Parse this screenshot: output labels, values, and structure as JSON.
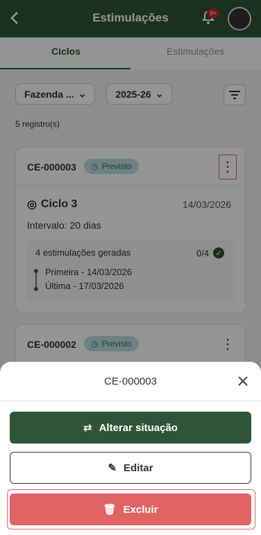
{
  "header": {
    "title": "Estimulações",
    "badge": "9+"
  },
  "tabs": [
    {
      "label": "Ciclos",
      "active": true
    },
    {
      "label": "Estimulações",
      "active": false
    }
  ],
  "filters": {
    "farm": "Fazenda ...",
    "season": "2025-26"
  },
  "results_count": "5 registro(s)",
  "cards": [
    {
      "code": "CE-000003",
      "status": "Previsto",
      "cycle_title": "Ciclo 3",
      "date": "14/03/2026",
      "interval": "Intervalo: 20 dias",
      "generated": "4 estimulações geradas",
      "progress": "0/4",
      "first": "Primeira - 14/03/2026",
      "last": "Última - 17/03/2026"
    },
    {
      "code": "CE-000002",
      "status": "Previsto"
    }
  ],
  "sheet": {
    "title": "CE-000003",
    "change_status": "Alterar situação",
    "edit": "Editar",
    "delete": "Excluir"
  },
  "colors": {
    "primary": "#2f5537",
    "danger": "#e06464",
    "status_bg": "#bfe0e0"
  }
}
